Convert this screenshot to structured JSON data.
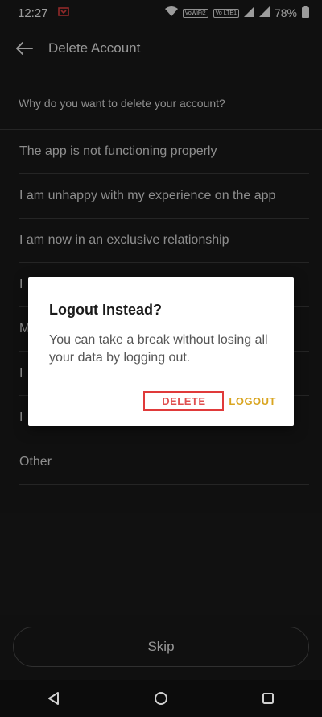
{
  "status_bar": {
    "time": "12:27",
    "battery": "78%",
    "badges": [
      "VoWiFi2",
      "Vo LTE1"
    ],
    "icons": [
      "cast-icon",
      "wifi-icon",
      "signal-icon",
      "signal-icon",
      "battery-icon"
    ]
  },
  "appbar": {
    "title": "Delete Account",
    "back_icon": "back-arrow-icon"
  },
  "question": "Why do you want to delete your account?",
  "reasons": [
    "The app is not functioning properly",
    "I am unhappy with my experience on the app",
    "I am now in an exclusive relationship",
    "I",
    "M",
    "I",
    "I",
    "Other"
  ],
  "dialog": {
    "title": "Logout Instead?",
    "message": "You can take a break without losing all your data by logging out.",
    "delete_label": "DELETE",
    "logout_label": "LOGOUT"
  },
  "skip_label": "Skip",
  "colors": {
    "background": "#1a1a1a",
    "dialog": "#ffffff",
    "delete": "#e03a3a",
    "logout": "#d9a520"
  }
}
